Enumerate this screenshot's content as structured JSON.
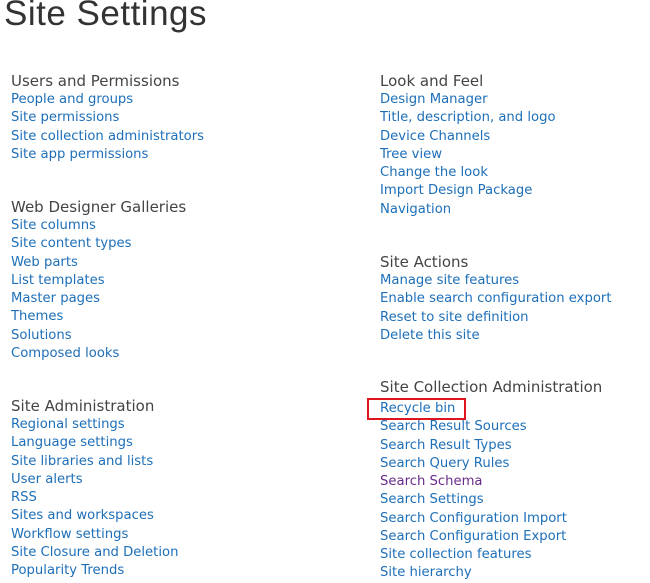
{
  "title": "Site Settings",
  "colors": {
    "link": "#1e6fb8",
    "visited": "#6a2c8a",
    "highlight": "#e0141e"
  },
  "sections": [
    {
      "heading": "Users and Permissions",
      "links": [
        "People and groups",
        "Site permissions",
        "Site collection administrators",
        "Site app permissions"
      ]
    },
    {
      "heading": "Web Designer Galleries",
      "links": [
        "Site columns",
        "Site content types",
        "Web parts",
        "List templates",
        "Master pages",
        "Themes",
        "Solutions",
        "Composed looks"
      ]
    },
    {
      "heading": "Site Administration",
      "links": [
        "Regional settings",
        "Language settings",
        "Site libraries and lists",
        "User alerts",
        "RSS",
        "Sites and workspaces",
        "Workflow settings",
        "Site Closure and Deletion",
        "Popularity Trends"
      ]
    },
    {
      "heading": "Look and Feel",
      "links": [
        "Design Manager",
        "Title, description, and logo",
        "Device Channels",
        "Tree view",
        "Change the look",
        "Import Design Package",
        "Navigation"
      ]
    },
    {
      "heading": "Site Actions",
      "links": [
        "Manage site features",
        "Enable search configuration export",
        "Reset to site definition",
        "Delete this site"
      ]
    },
    {
      "heading": "Site Collection Administration",
      "links": [
        "Recycle bin",
        "Search Result Sources",
        "Search Result Types",
        "Search Query Rules",
        "Search Schema",
        "Search Settings",
        "Search Configuration Import",
        "Search Configuration Export",
        "Site collection features",
        "Site hierarchy"
      ]
    }
  ]
}
